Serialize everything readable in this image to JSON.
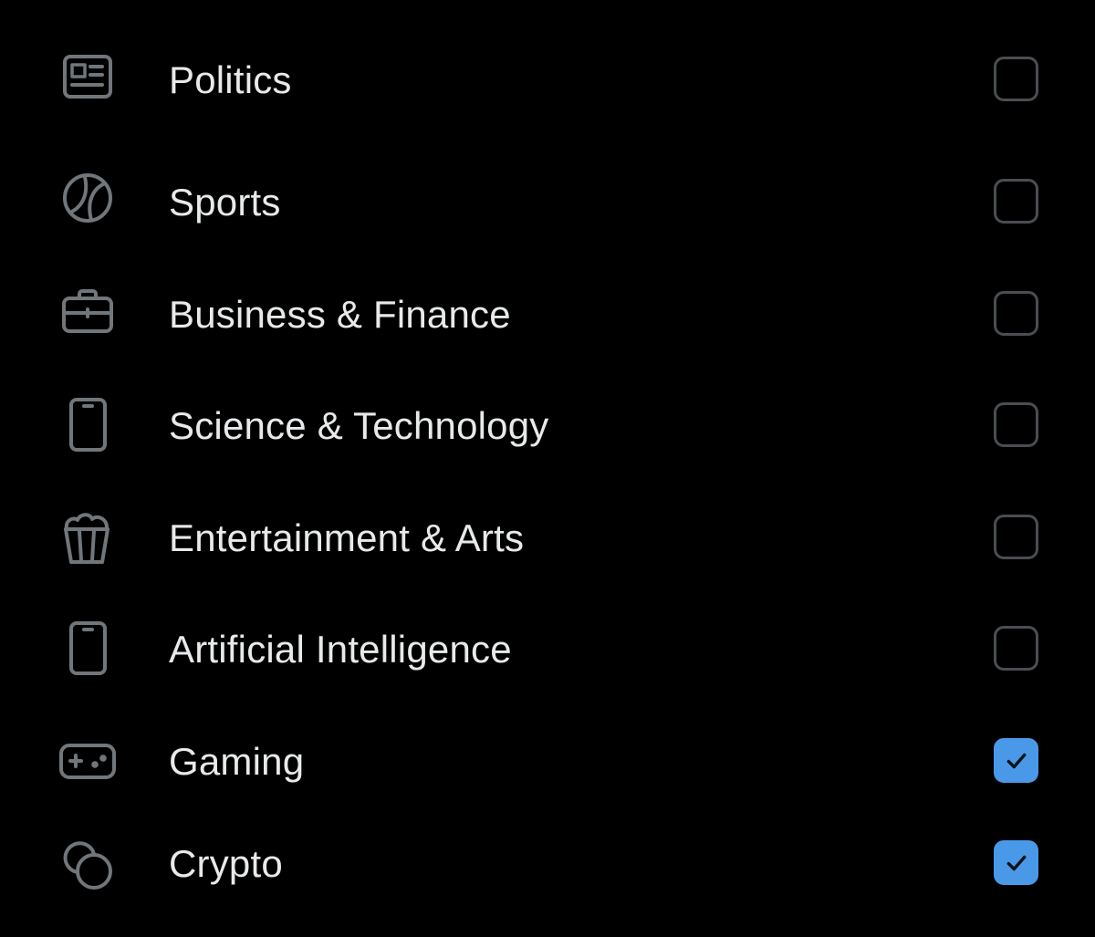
{
  "colors": {
    "background": "#000000",
    "text": "#e7e9ea",
    "icon": "#71767b",
    "checkbox_border": "#4a4d51",
    "checkbox_checked": "#4a99e9"
  },
  "topics": [
    {
      "label": "Politics",
      "icon": "newspaper-icon",
      "checked": false
    },
    {
      "label": "Sports",
      "icon": "ball-icon",
      "checked": false
    },
    {
      "label": "Business & Finance",
      "icon": "briefcase-icon",
      "checked": false
    },
    {
      "label": "Science & Technology",
      "icon": "phone-icon",
      "checked": false
    },
    {
      "label": "Entertainment & Arts",
      "icon": "popcorn-icon",
      "checked": false
    },
    {
      "label": "Artificial Intelligence",
      "icon": "phone-icon",
      "checked": false
    },
    {
      "label": "Gaming",
      "icon": "gamepad-icon",
      "checked": true
    },
    {
      "label": "Crypto",
      "icon": "coins-icon",
      "checked": true
    }
  ]
}
